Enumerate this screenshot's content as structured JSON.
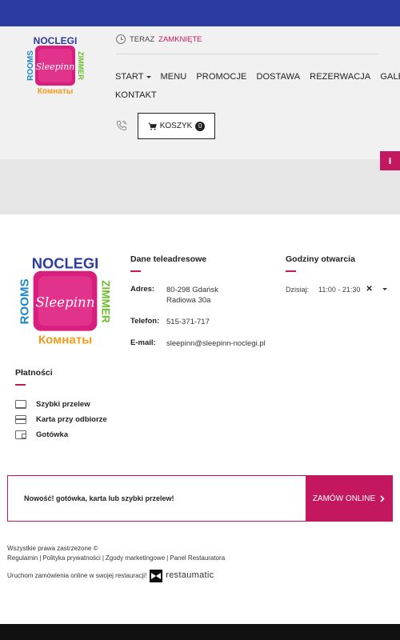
{
  "status": {
    "prefix": "TERAZ",
    "value": "ZAMKNIĘTE"
  },
  "nav": {
    "row1": [
      "START",
      "MENU",
      "PROMOCJE",
      "DOSTAWA",
      "REZERWACJA",
      "GALERIA"
    ],
    "row2": [
      "KONTAKT"
    ]
  },
  "cart": {
    "label": "KOSZYK",
    "count": "0"
  },
  "logo": {
    "top": "NOCLEGI",
    "left": "ROOMS",
    "right": "ZIMMER",
    "center": "Sleepinn",
    "bottom": "Комнаты"
  },
  "contact": {
    "title": "Dane teleadresowe",
    "address_label": "Adres:",
    "address_line1": "80-298 Gdańsk",
    "address_line2": "Radiowa 30a",
    "phone_label": "Telefon:",
    "phone": "515-371-717",
    "email_label": "E-mail:",
    "email": "sleepinn@sleepinn-noclegi.pl"
  },
  "hours": {
    "title": "Godziny otwarcia",
    "day": "Dzisiaj:",
    "time": "11:00 - 21:30",
    "close_mark": "✕"
  },
  "payments": {
    "title": "Płatności",
    "items": [
      "Szybki przelew",
      "Karta przy odbiorze",
      "Gotówka"
    ]
  },
  "promo": {
    "text": "Nowość! gotówka, karta lub szybki przelew!",
    "button": "ZAMÓW ONLINE"
  },
  "legal": {
    "rights": "Wszystkie prawa zastrzeżone ©",
    "links": [
      "Regulamin",
      "Polityka prywatności",
      "Zgody marketingowe",
      "Panel Restauratora"
    ],
    "run_text": "Uruchom zamówienia online w swojej restauracji!",
    "brand": "restaumatic"
  },
  "colors": {
    "top_bar": "#2b3ca0",
    "accent": "#c3185f"
  }
}
